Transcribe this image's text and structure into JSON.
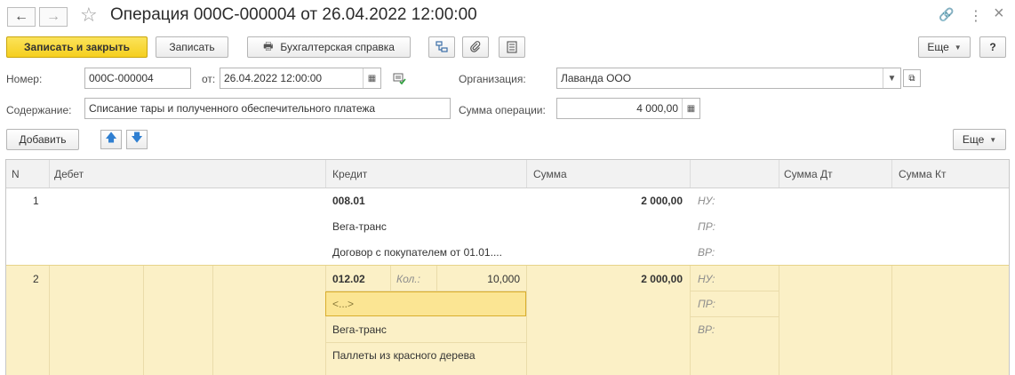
{
  "window": {
    "title": "Операция 000С-000004 от 26.04.2022 12:00:00",
    "back_glyph": "←",
    "forward_glyph": "→",
    "star_glyph": "☆",
    "link_glyph": "🔗",
    "more_glyph": "⋮",
    "close_glyph": "×"
  },
  "toolbar": {
    "save_close": "Записать и закрыть",
    "save": "Записать",
    "report": "Бухгалтерская справка",
    "report_icon": "🖶",
    "more": "Еще",
    "help": "?"
  },
  "form": {
    "number_label": "Номер:",
    "number_value": "000С-000004",
    "date_label": "от:",
    "date_value": "26.04.2022 12:00:00",
    "org_label": "Организация:",
    "org_value": "Лаванда ООО",
    "content_label": "Содержание:",
    "content_value": "Списание тары и полученного обеспечительного платежа",
    "sum_label": "Сумма операции:",
    "sum_value": "4 000,00"
  },
  "table_toolbar": {
    "add": "Добавить",
    "up_glyph": "🡅",
    "down_glyph": "🡇",
    "more": "Еще"
  },
  "table": {
    "columns": [
      "N",
      "Дебет",
      "Кредит",
      "Сумма",
      "Сумма Дт",
      "Сумма Кт"
    ],
    "rows": [
      {
        "n": "1",
        "credit_account": "008.01",
        "credit_sub1": "Вега-транс",
        "credit_sub2": "Договор с покупателем от 01.01....",
        "sum": "2 000,00",
        "nu": "НУ:",
        "pr": "ПР:",
        "vr": "ВР:"
      },
      {
        "n": "2",
        "credit_account": "012.02",
        "qty_label": "Кол.:",
        "qty_value": "10,000",
        "credit_sub0": "<...>",
        "credit_sub1": "Вега-транс",
        "credit_sub2": "Паллеты из красного дерева",
        "sum": "2 000,00",
        "nu": "НУ:",
        "pr": "ПР:",
        "vr": "ВР:"
      }
    ]
  }
}
